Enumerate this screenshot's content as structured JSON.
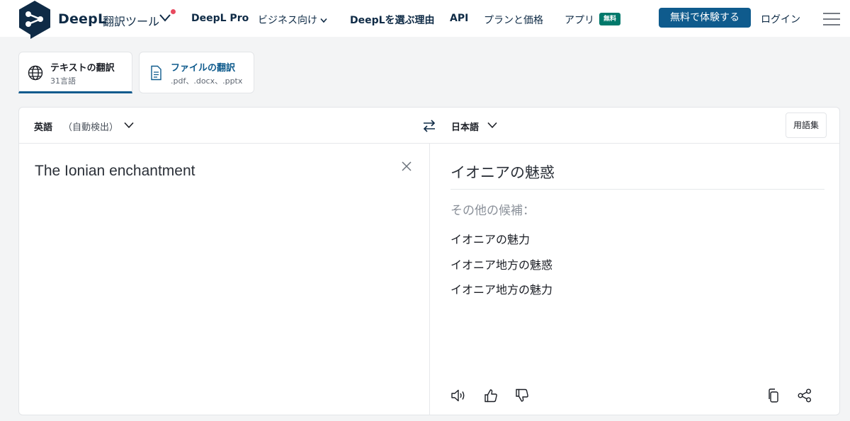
{
  "header": {
    "brand": "DeepL",
    "brand_sub": "翻訳ツール",
    "nav": [
      "DeepL Pro",
      "ビジネス向け",
      "DeepLを選ぶ理由",
      "API",
      "プランと価格",
      "アプリ"
    ],
    "app_badge": "無料",
    "trial_button": "無料で体験する",
    "login": "ログイン"
  },
  "tabs": [
    {
      "title": "テキストの翻訳",
      "sub": "31言語"
    },
    {
      "title": "ファイルの翻訳",
      "sub": ".pdf、.docx、.pptx"
    }
  ],
  "translator": {
    "source_lang": "英語",
    "source_auto": "（自動検出）",
    "target_lang": "日本語",
    "glossary": "用語集",
    "source_text": "The Ionian enchantment",
    "target_text": "イオニアの魅惑",
    "alternatives_label": "その他の候補：",
    "alternatives": [
      "イオニアの魅力",
      "イオニア地方の魅惑",
      "イオニア地方の魅力"
    ]
  },
  "colors": {
    "accent": "#0f5b8d",
    "brand_navy": "#0f2b46",
    "badge_green": "#00796b",
    "notify_red": "#e84a5f"
  }
}
